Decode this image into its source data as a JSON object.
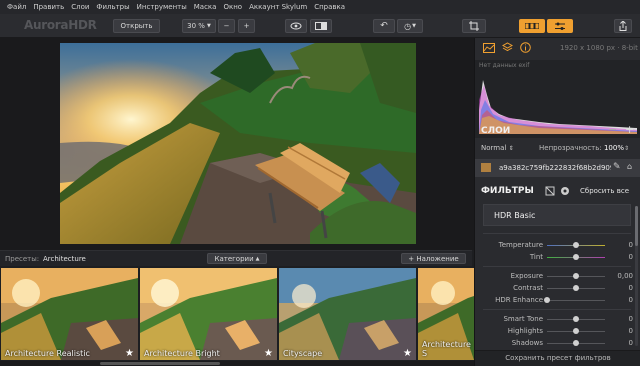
{
  "menu": [
    "Файл",
    "Править",
    "Слои",
    "Фильтры",
    "Инструменты",
    "Маска",
    "Окно",
    "Аккаунт Skylum",
    "Справка"
  ],
  "app_logo": "AuroraHDR",
  "toolbar": {
    "open_label": "Открыть",
    "zoom": "30 %"
  },
  "presets": {
    "label": "Пресеты:",
    "current": "Architecture",
    "categories_label": "Категории",
    "overlay_label": "+ Наложение",
    "items": [
      {
        "name": "Architecture Realistic"
      },
      {
        "name": "Architecture Bright"
      },
      {
        "name": "Cityscape"
      },
      {
        "name": "Architecture S"
      }
    ]
  },
  "info": {
    "resolution": "1920 x 1080 px",
    "bit_depth": "8-bit",
    "no_data": "Нет данных exif"
  },
  "layers": {
    "title": "СЛОИ",
    "blend_mode": "Normal",
    "opacity_label": "Непрозрачность:",
    "opacity_value": "100%",
    "layer_name": "a9a382c759fb222832f68b2d909.j..."
  },
  "filters": {
    "title": "ФИЛЬТРЫ",
    "reset_label": "Сбросить все",
    "active_filter": "HDR Basic",
    "sliders": [
      {
        "name": "Temperature",
        "value": "0",
        "pos": 0.5
      },
      {
        "name": "Tint",
        "value": "0",
        "pos": 0.5
      },
      {
        "name": "Exposure",
        "value": "0,00",
        "pos": 0.5
      },
      {
        "name": "Contrast",
        "value": "0",
        "pos": 0.5
      },
      {
        "name": "HDR Enhance",
        "value": "0",
        "pos": 0.0
      },
      {
        "name": "Smart Tone",
        "value": "0",
        "pos": 0.5
      },
      {
        "name": "Highlights",
        "value": "0",
        "pos": 0.5
      },
      {
        "name": "Shadows",
        "value": "0",
        "pos": 0.5
      }
    ],
    "save_preset_label": "Сохранить пресет фильтров"
  },
  "colors": {
    "accent": "#f0a030",
    "temp_track": "#b8a830",
    "tint_track": "#b040b0"
  }
}
